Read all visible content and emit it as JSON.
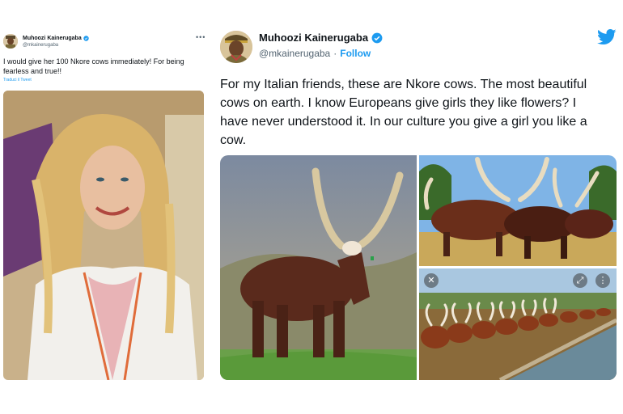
{
  "left_tweet": {
    "author_name": "Muhoozi Kainerugaba",
    "handle": "@mkainerugaba",
    "more_icon": "•••",
    "text": "I would give her 100 Nkore cows immediately! For being fearless and true!!",
    "translate_link": "Traduci il Tweet",
    "photo_icon": "portrait-photo"
  },
  "right_tweet": {
    "author_name": "Muhoozi Kainerugaba",
    "handle": "@mkainerugaba",
    "separator": "·",
    "follow_label": "Follow",
    "text": "For my Italian friends, these are Nkore cows. The most beautiful cows on earth. I know Europeans give girls they like flowers? I have never understood it. In our culture you give a girl you like a cow.",
    "media": [
      {
        "name": "single-cow-photo"
      },
      {
        "name": "herd-photo"
      },
      {
        "name": "drinking-cows-photo",
        "buttons": {
          "close": "✕",
          "expand": "⤢",
          "more": "⋮"
        }
      }
    ]
  },
  "colors": {
    "twitter_blue": "#1d9bf0",
    "text": "#0f1419",
    "secondary": "#536471"
  }
}
